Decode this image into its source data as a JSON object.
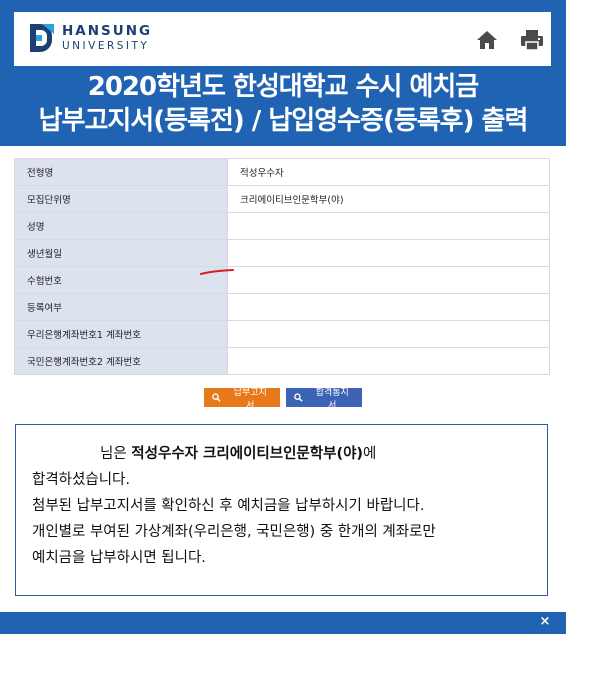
{
  "header": {
    "logo_line1": "HANSUNG",
    "logo_line2": "UNIVERSITY"
  },
  "title": {
    "line1": "2020학년도 한성대학교 수시 예치금",
    "line2": "납부고지서(등록전) / 납입영수증(등록후) 출력"
  },
  "info_rows": [
    {
      "label": "전형명",
      "value": "적성우수자"
    },
    {
      "label": "모집단위명",
      "value": "크리에이티브인문학부(야)"
    },
    {
      "label": "성명",
      "value": ""
    },
    {
      "label": "생년월일",
      "value": ""
    },
    {
      "label": "수험번호",
      "value": ""
    },
    {
      "label": "등록여부",
      "value": ""
    },
    {
      "label": "우리은행계좌번호1 계좌번호",
      "value": ""
    },
    {
      "label": "국민은행계좌번호2 계좌번호",
      "value": ""
    }
  ],
  "buttons": {
    "notice_label": "납부고지서",
    "pass_label": "합격통지서"
  },
  "message": {
    "line1_prefix": "님은",
    "line1_bold": "적성우수자 크리에이티브인문학부(야)",
    "line1_suffix": "에",
    "line2": "합격하셨습니다.",
    "line3": "첨부된 납부고지서를 확인하신 후 예치금을 납부하시기 바랍니다.",
    "line4": "개인별로 부여된 가상계좌(우리은행, 국민은행) 중 한개의 계좌로만",
    "line5": "예치금을 납부하시면 됩니다."
  },
  "close_symbol": "×",
  "colors": {
    "frame_blue": "#1f63b2",
    "notice_orange": "#e8791a",
    "pass_blue": "#3d63b5",
    "label_bg": "#dde3ee"
  },
  "icons": [
    "hansung-logo-icon",
    "home-icon",
    "print-icon",
    "search-icon",
    "close-icon"
  ]
}
